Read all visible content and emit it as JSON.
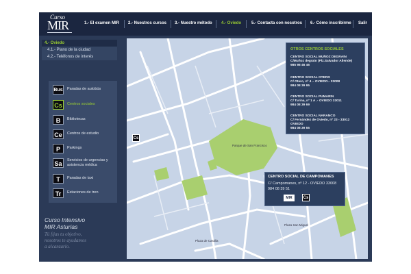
{
  "logo": {
    "curso": "Curso",
    "mir": "MIR"
  },
  "nav": [
    {
      "label": "1.- El examen MIR"
    },
    {
      "label": "2.- Nuestros cursos"
    },
    {
      "label": "3.- Nuestro método"
    },
    {
      "label": "4.- Oviedo"
    },
    {
      "label": "5.- Contacta con nosotros"
    },
    {
      "label": "6.- Cómo inscribirme"
    },
    {
      "label": "Salir"
    }
  ],
  "submenu": {
    "title": "4.- Oviedo",
    "items": [
      "4.1.- Plano de la ciudad",
      "4.2.- Teléfonos de interés"
    ]
  },
  "legend": [
    {
      "code": "Bus",
      "label": "Paradas de autobús"
    },
    {
      "code": "Cs",
      "label": "Centros sociales"
    },
    {
      "code": "B",
      "label": "Bibliotecas"
    },
    {
      "code": "Ce",
      "label": "Centros de estudio"
    },
    {
      "code": "P",
      "label": "Parkings"
    },
    {
      "code": "Sa",
      "label": "Servicios de urgencias y asistencia médica"
    },
    {
      "code": "T",
      "label": "Paradas de taxi"
    },
    {
      "code": "Tr",
      "label": "Estaciones de tren"
    }
  ],
  "brand": {
    "title1": "Curso Intensivo",
    "title2": "MIR Asturias",
    "tag1": "Tú fijas tu objetivo,",
    "tag2": "nosotros te ayudamos",
    "tag3": "a alcanzarlo."
  },
  "centers": {
    "header": "OTROS CENTROS SOCIALES",
    "items": [
      {
        "name": "CENTRO SOCIAL MUÑOZ DEGRAIN",
        "addr": "C/Muñoz degrain (Plz.Salvador Allende)",
        "phone": "985 98 46 46"
      },
      {
        "name": "CENTRO SOCIAL OTERO",
        "addr": "C/ Otero, nº 4 .- OVIEDO.- 33008",
        "phone": "984 08 39 95"
      },
      {
        "name": "CENTRO SOCIAL PUMARIN",
        "addr": "C/ Turina, nº 1 A .- OVIEDO 33011",
        "phone": "984 08 39 69"
      },
      {
        "name": "CENTRO SOCIAL NARANCO",
        "addr": "C/ Fernández de Oviedo, nº 23 - 33012",
        "addr2": "OVIEDO",
        "phone": "984 08 39 55"
      }
    ]
  },
  "popup": {
    "title": "CENTRO SOCIAL DE CAMPOMANES",
    "addr": "C/ Campomanes, nº 12 - OVIEDO 33008",
    "phone": "984 08 39 51",
    "marker": "Cs",
    "logo": "MIR"
  },
  "map_marker": "Cs",
  "map_labels": {
    "parque": "Parque de San Francisco",
    "plaza": "Plaza de Castilla",
    "plaza2": "Plaza San Miguel"
  },
  "colors": {
    "accent": "#9acd32",
    "panel": "#2b3a57",
    "map_bg": "#c7d4e7",
    "park": "#a9cf6f"
  }
}
